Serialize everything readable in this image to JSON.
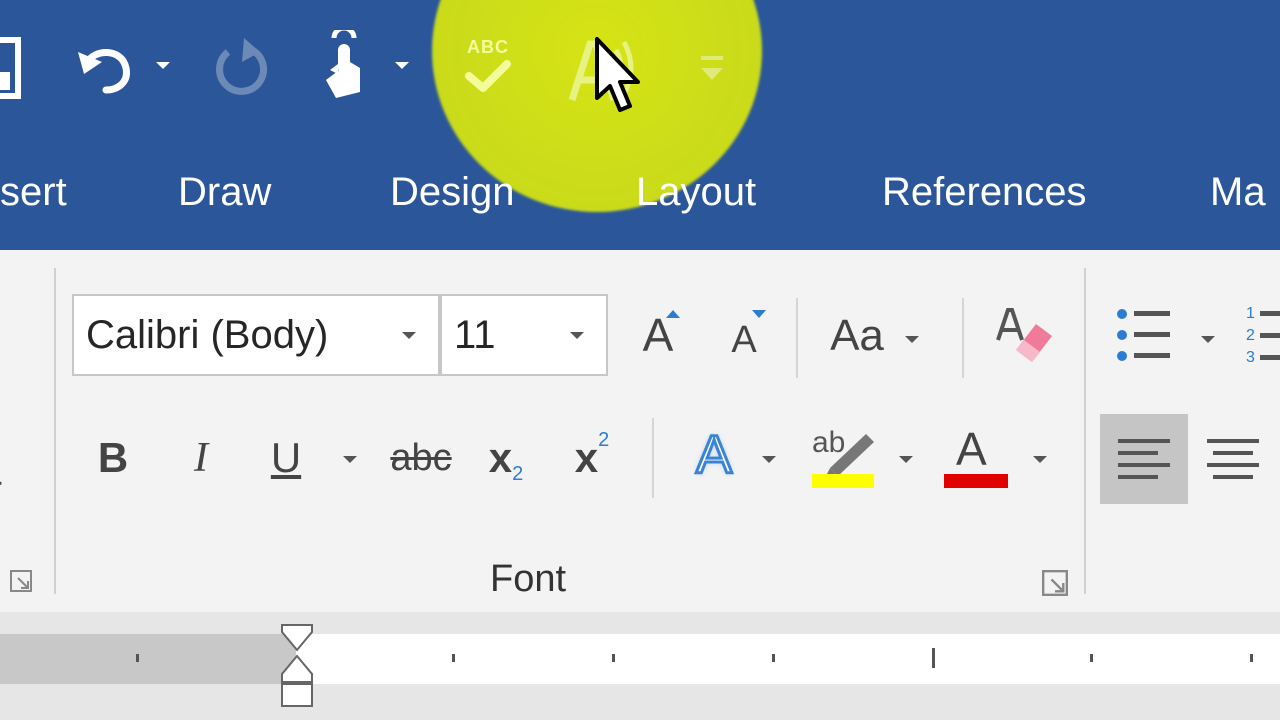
{
  "qat": {
    "save_icon": "save-icon",
    "undo_icon": "undo-icon",
    "redo_icon": "redo-icon",
    "touch_icon": "touch-mode-icon",
    "spelling_label": "ABC",
    "read_aloud_icon": "read-aloud-icon",
    "customize_icon": "customize-qat-icon"
  },
  "tabs": [
    {
      "label": "sert"
    },
    {
      "label": "Draw"
    },
    {
      "label": "Design"
    },
    {
      "label": "Layout"
    },
    {
      "label": "References"
    },
    {
      "label": "Ma"
    }
  ],
  "font_group": {
    "font_name": "Calibri (Body)",
    "font_size": "11",
    "grow_font_label": "A",
    "shrink_font_label": "A",
    "change_case_label": "Aa",
    "bold_label": "B",
    "italic_label": "I",
    "underline_label": "U",
    "strikethrough_label": "abc",
    "subscript_label": "x",
    "subscript_mark": "2",
    "superscript_label": "x",
    "superscript_mark": "2",
    "text_effects_label": "A",
    "highlight_label": "ab",
    "font_color_label": "A",
    "group_label": "Font"
  },
  "colors": {
    "title_bar": "#2b579a",
    "cursor_highlight": "#d6e414",
    "highlight_swatch": "#ffff00",
    "font_color_swatch": "#e00000"
  }
}
